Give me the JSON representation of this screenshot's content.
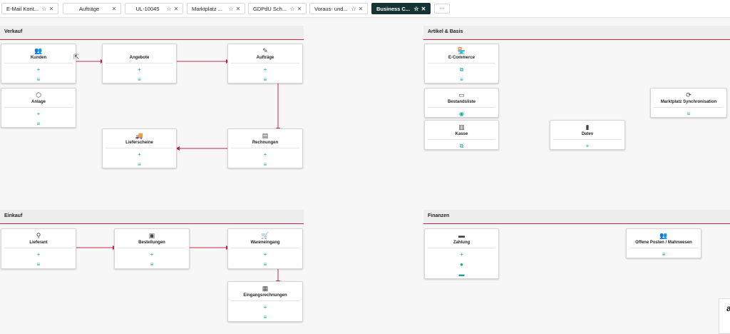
{
  "tabs": [
    {
      "label": "E-Mail Kont...",
      "icons": [
        "star-icon",
        "close-icon"
      ],
      "active": false
    },
    {
      "label": "Aufträge",
      "icons": [
        "close-icon"
      ],
      "active": false
    },
    {
      "label": "UL-10045",
      "icons": [
        "star-icon",
        "close-icon"
      ],
      "active": false
    },
    {
      "label": "Marktplatz ...",
      "icons": [
        "star-icon",
        "close-icon"
      ],
      "active": false
    },
    {
      "label": "GDPdU Sch...",
      "icons": [
        "star-icon",
        "close-icon"
      ],
      "active": false
    },
    {
      "label": "Voraus- und...",
      "icons": [
        "star-icon",
        "close-icon"
      ],
      "active": false
    },
    {
      "label": "Business C...",
      "icons": [
        "star-icon",
        "close-icon"
      ],
      "active": true
    }
  ],
  "more_label": "···",
  "glyphs": {
    "star": "☆",
    "close": "✕",
    "plus": "+",
    "list": "≡",
    "eye": "◉",
    "link": "⧉",
    "person": "●",
    "card": "▬",
    "cycle": "⟳"
  },
  "sections": {
    "verkauf": "Verkauf",
    "artikel": "Artikel & Basis",
    "einkauf": "Einkauf",
    "finanzen": "Finanzen"
  },
  "cards": {
    "kunden": {
      "title": "Kunden",
      "icon": "users-icon",
      "glyph": "👥"
    },
    "angebote": {
      "title": "Angebote",
      "icon": "",
      "glyph": ""
    },
    "auftraege": {
      "title": "Aufträge",
      "icon": "checklist-edit-icon",
      "glyph": "✎"
    },
    "anlage": {
      "title": "Anlage",
      "icon": "box-icon",
      "glyph": "⬡"
    },
    "lieferscheine": {
      "title": "Lieferscheine",
      "icon": "truck-icon",
      "glyph": "🚚"
    },
    "rechnungen": {
      "title": "Rechnungen",
      "icon": "receipt-icon",
      "glyph": "▤"
    },
    "ecommerce": {
      "title": "E-Commerce",
      "icon": "store-icon",
      "glyph": "🏪"
    },
    "bestandsliste": {
      "title": "Bestandsliste",
      "icon": "inventory-icon",
      "glyph": "▭"
    },
    "kasse": {
      "title": "Kasse",
      "icon": "register-icon",
      "glyph": "▥"
    },
    "datev": {
      "title": "Datev",
      "icon": "document-icon",
      "glyph": "▮"
    },
    "marktplatz_sync": {
      "title": "Marktplatz Synchronisation",
      "icon": "sync-icon",
      "glyph": "⟳"
    },
    "lieferant": {
      "title": "Lieferant",
      "icon": "supplier-icon",
      "glyph": "⚲"
    },
    "bestellungen": {
      "title": "Bestellungen",
      "icon": "package-icon",
      "glyph": "▣"
    },
    "wareneingang": {
      "title": "Wareneingang",
      "icon": "cart-icon",
      "glyph": "🛒"
    },
    "eingangsrechnungen": {
      "title": "Eingangsrechnungen",
      "icon": "invoice-icon",
      "glyph": "▦"
    },
    "zahlung": {
      "title": "Zahlung",
      "icon": "payment-icon",
      "glyph": "▬"
    },
    "offene_posten": {
      "title": "Offene Posten / Mahnwesen",
      "icon": "people-icon",
      "glyph": "👥"
    }
  },
  "corner_label": "a",
  "colors": {
    "accent": "#c0284a",
    "action": "#17a398",
    "active_tab": "#153433"
  }
}
